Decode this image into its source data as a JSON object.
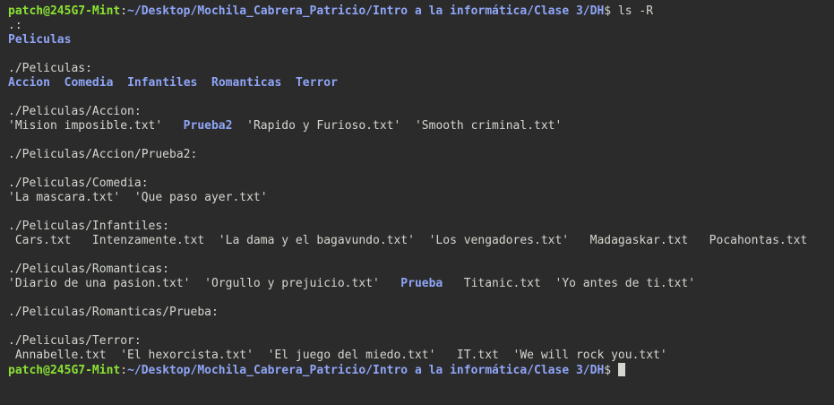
{
  "prompt": {
    "user_host": "patch@245G7-Mint",
    "sep": ":",
    "path": "~/Desktop/Mochila_Cabrera_Patricio/Intro a la informática/Clase 3/DH",
    "dollar": "$",
    "command": " ls -R"
  },
  "lines": {
    "l1": ".:",
    "l2": "Peliculas",
    "l4": "./Peliculas:",
    "l5": [
      {
        "text": "Accion",
        "dir": true
      },
      {
        "text": "  ",
        "dir": false
      },
      {
        "text": "Comedia",
        "dir": true
      },
      {
        "text": "  ",
        "dir": false
      },
      {
        "text": "Infantiles",
        "dir": true
      },
      {
        "text": "  ",
        "dir": false
      },
      {
        "text": "Romanticas",
        "dir": true
      },
      {
        "text": "  ",
        "dir": false
      },
      {
        "text": "Terror",
        "dir": true
      }
    ],
    "l7": "./Peliculas/Accion:",
    "l8": [
      {
        "text": "'Mision imposible.txt'   ",
        "dir": false
      },
      {
        "text": "Prueba2",
        "dir": true
      },
      {
        "text": "  'Rapido y Furioso.txt'  'Smooth criminal.txt'",
        "dir": false
      }
    ],
    "l10": "./Peliculas/Accion/Prueba2:",
    "l12": "./Peliculas/Comedia:",
    "l13": "'La mascara.txt'  'Que paso ayer.txt'",
    "l15": "./Peliculas/Infantiles:",
    "l16": " Cars.txt   Intenzamente.txt  'La dama y el bagavundo.txt'  'Los vengadores.txt'   Madagaskar.txt   Pocahontas.txt",
    "l18": "./Peliculas/Romanticas:",
    "l19": [
      {
        "text": "'Diario de una pasion.txt'  'Orgullo y prejuicio.txt'   ",
        "dir": false
      },
      {
        "text": "Prueba",
        "dir": true
      },
      {
        "text": "   Titanic.txt  'Yo antes de ti.txt'",
        "dir": false
      }
    ],
    "l21": "./Peliculas/Romanticas/Prueba:",
    "l23": "./Peliculas/Terror:",
    "l24": " Annabelle.txt  'El hexorcista.txt'  'El juego del miedo.txt'   IT.txt  'We will rock you.txt'"
  },
  "colors": {
    "background": "#2b2b2b",
    "text": "#d3d7cf",
    "prompt_user": "#8ae234",
    "directory": "#8fa5f7"
  }
}
